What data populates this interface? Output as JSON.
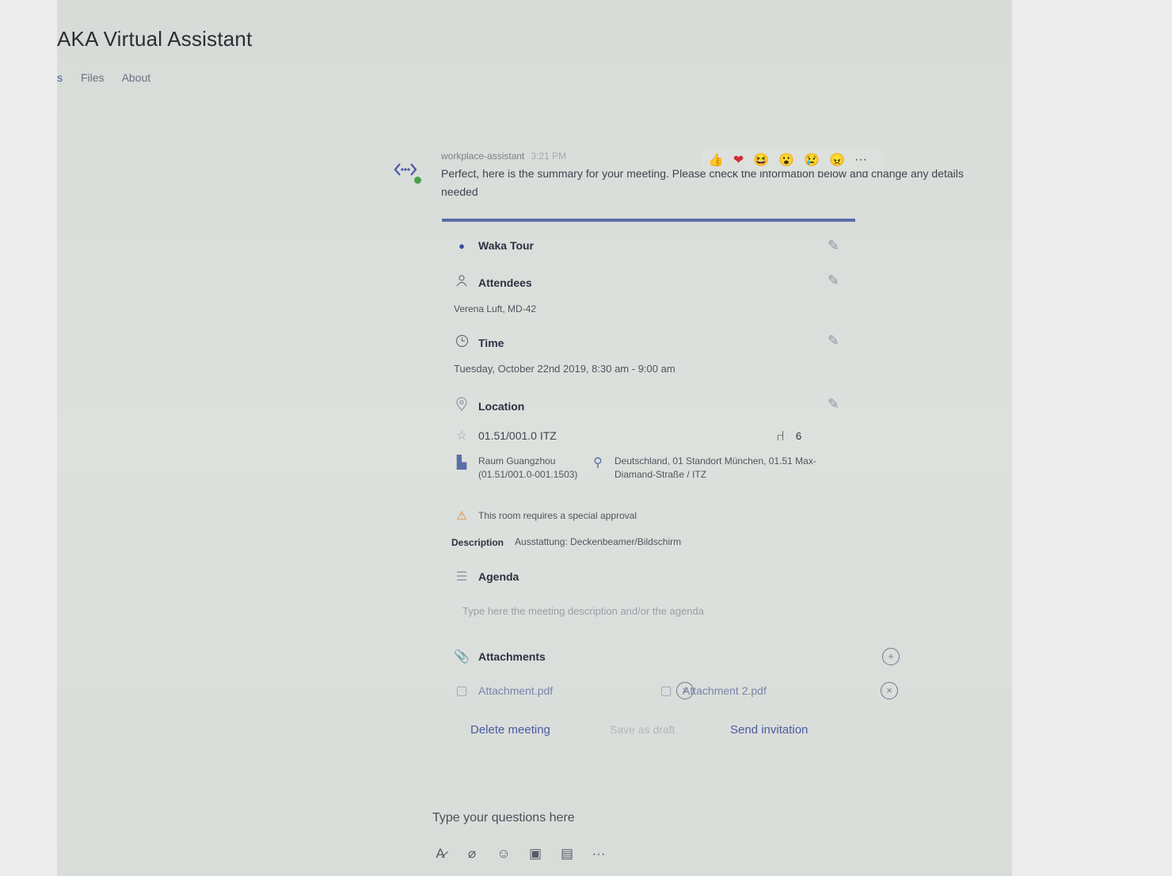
{
  "app": {
    "title": "AKA Virtual Assistant"
  },
  "tabs": [
    {
      "label": "s",
      "active": true
    },
    {
      "label": "Files",
      "active": false
    },
    {
      "label": "About",
      "active": false
    }
  ],
  "message": {
    "sender": "workplace-assistant",
    "time": "3:21 PM",
    "text": "Perfect, here is the summary for your meeting. Please check the information below and change any details needed"
  },
  "reactions": [
    "👍",
    "❤",
    "😆",
    "😮",
    "😢",
    "😠"
  ],
  "reactions_more": "···",
  "card": {
    "accent_color": "#5a6ea6",
    "title": "Waka Tour",
    "attendees_label": "Attendees",
    "attendees_value": "Verena Luft, MD-42",
    "time_label": "Time",
    "time_value": "Tuesday, October 22nd 2019, 8:30 am - 9:00 am",
    "location_label": "Location",
    "room_code": "01.51/001.0 ITZ",
    "seats": "6",
    "room_name": "Raum Guangzhou (01.51/001.0-001.1503)",
    "address": "Deutschland, 01 Standort München, 01.51 Max-Diamand-Straße / ITZ",
    "warning": "This room requires a special approval",
    "description_label": "Description",
    "description_value": "Ausstattung: Deckenbeamer/Bildschirm",
    "agenda_label": "Agenda",
    "agenda_placeholder": "Type here the meeting description and/or the agenda",
    "attachments_label": "Attachments",
    "attachments": [
      "Attachment.pdf",
      "Attachment 2.pdf"
    ],
    "buttons": {
      "delete": "Delete meeting",
      "draft": "Save as draft",
      "send": "Send invitation"
    }
  },
  "compose": {
    "placeholder": "Type your questions here"
  },
  "toolbar_more": "···"
}
